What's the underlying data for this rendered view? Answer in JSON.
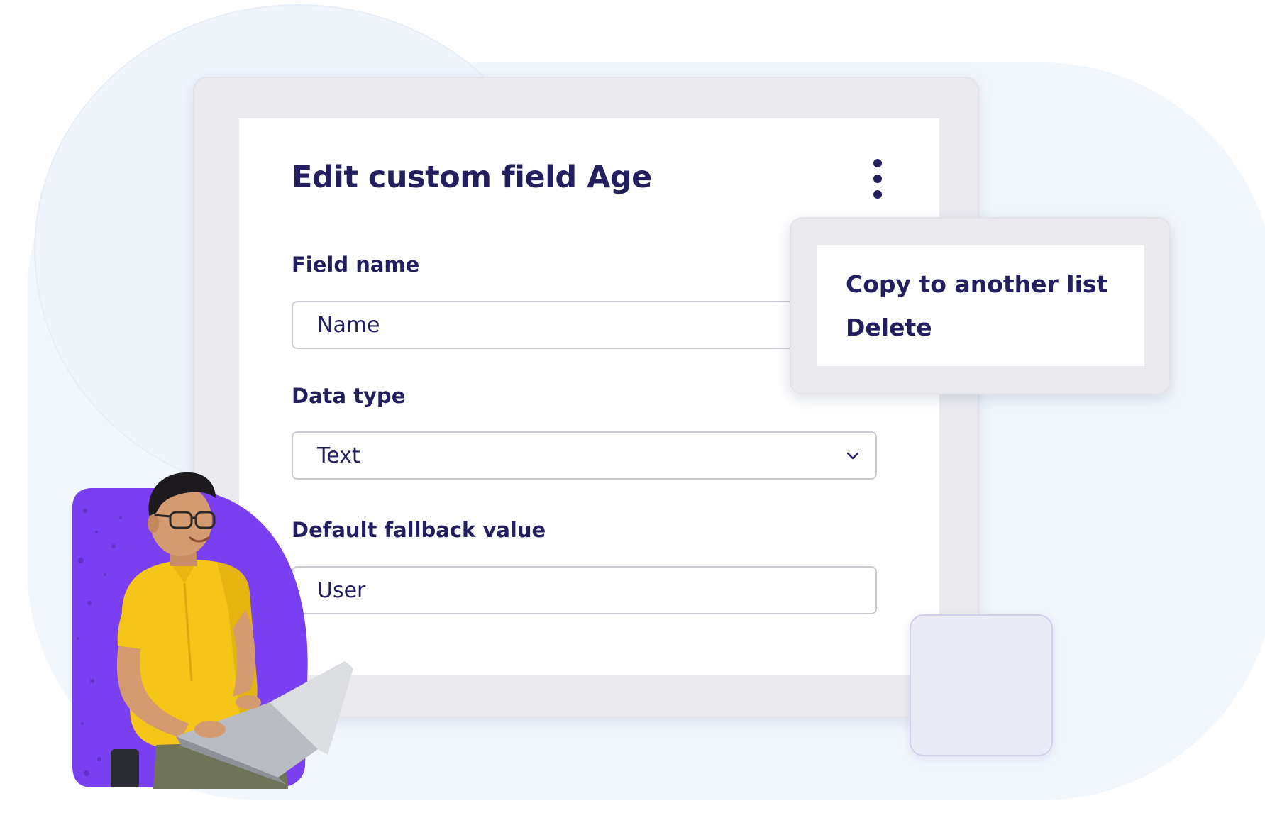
{
  "dialog": {
    "title": "Edit custom field Age",
    "more_icon": "more-vertical-icon"
  },
  "form": {
    "field_name": {
      "label": "Field name",
      "value": "Name"
    },
    "data_type": {
      "label": "Data type",
      "value": "Text",
      "icon": "chevron-down-icon"
    },
    "fallback": {
      "label": "Default fallback value",
      "value": "User"
    }
  },
  "menu": {
    "items": [
      {
        "label": "Copy to another list"
      },
      {
        "label": "Delete"
      }
    ]
  },
  "colors": {
    "text": "#231e5e",
    "accent_purple": "#7b3ff2",
    "shirt_yellow": "#f5c518",
    "frame": "#ebebef",
    "background_blob": "#f2f7fc"
  }
}
